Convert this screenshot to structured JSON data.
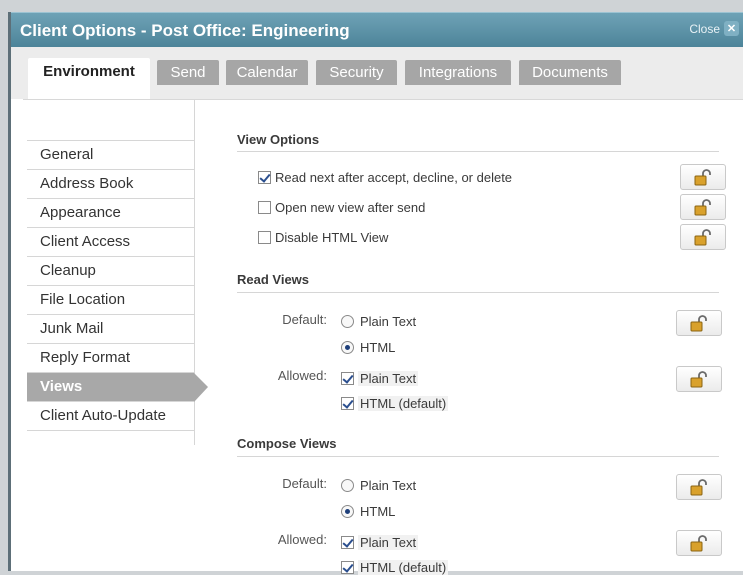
{
  "window": {
    "title": "Client Options - Post Office: Engineering",
    "close_label": "Close",
    "close_icon": "close-x-icon"
  },
  "tabs": [
    "Environment",
    "Send",
    "Calendar",
    "Security",
    "Integrations",
    "Documents"
  ],
  "sidebar": {
    "items": [
      "General",
      "Address Book",
      "Appearance",
      "Client Access",
      "Cleanup",
      "File Location",
      "Junk Mail",
      "Reply Format",
      "Views",
      "Client Auto-Update"
    ],
    "active": "Views"
  },
  "view_options": {
    "title": "View Options",
    "items": [
      {
        "label": "Read next after accept, decline, or delete",
        "checked": true
      },
      {
        "label": "Open new view after send",
        "checked": false
      },
      {
        "label": "Disable HTML View",
        "checked": false
      }
    ]
  },
  "read_views": {
    "title": "Read Views",
    "default_label": "Default:",
    "default_options": [
      {
        "label": "Plain Text",
        "selected": false
      },
      {
        "label": "HTML",
        "selected": true
      }
    ],
    "allowed_label": "Allowed:",
    "allowed_options": [
      {
        "label": "Plain Text",
        "checked": true
      },
      {
        "label": "HTML (default)",
        "checked": true
      }
    ]
  },
  "compose_views": {
    "title": "Compose Views",
    "default_label": "Default:",
    "default_options": [
      {
        "label": "Plain Text",
        "selected": false
      },
      {
        "label": "HTML",
        "selected": true
      }
    ],
    "allowed_label": "Allowed:",
    "allowed_options": [
      {
        "label": "Plain Text",
        "checked": true
      },
      {
        "label": "HTML (default)",
        "checked": true
      }
    ]
  },
  "colors": {
    "titlebar": "#5a92a7",
    "tab_inactive": "#a6a6a6",
    "active_nav": "#a8a8a8",
    "lock": "#d9a12c"
  },
  "icons": {
    "lock": "unlocked-padlock-icon"
  }
}
